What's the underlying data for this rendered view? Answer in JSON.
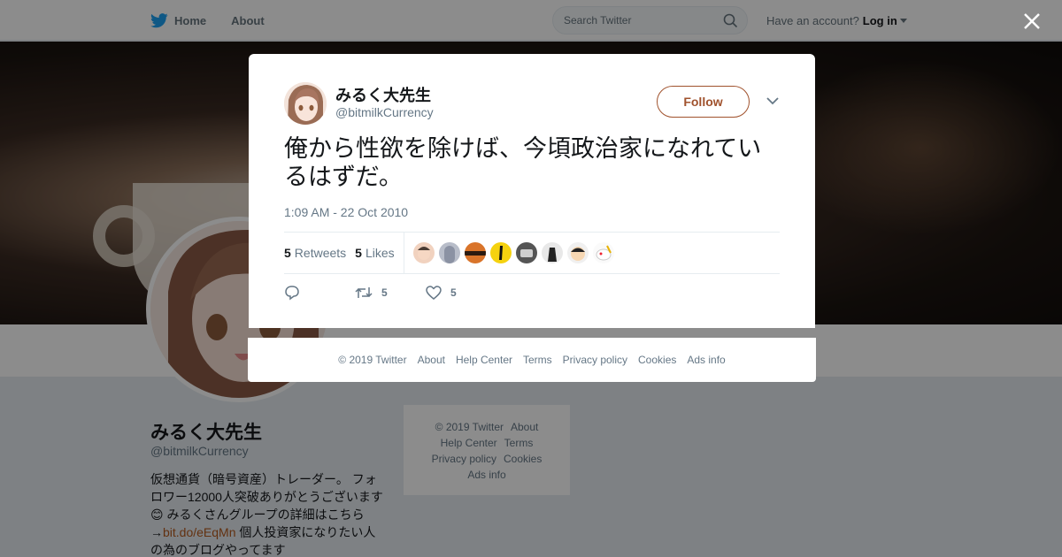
{
  "topbar": {
    "home_label": "Home",
    "about_label": "About",
    "search_placeholder": "Search Twitter",
    "account_prompt": "Have an account?",
    "login_label": "Log in"
  },
  "profile": {
    "name": "みるく大先生",
    "handle": "@bitmilkCurrency",
    "bio_part1": "仮想通貨（暗号資産）トレーダー。 フォロワー12000人突破ありがとうございます😊 みるくさんグループの詳細はこちら→",
    "bio_link": "bit.do/eEqMn",
    "bio_part2": " 個人投資家になりたい人の為のブログやってます"
  },
  "side_footer": {
    "copyright": "© 2019 Twitter",
    "about": "About",
    "help": "Help Center",
    "terms": "Terms",
    "privacy": "Privacy policy",
    "cookies": "Cookies",
    "ads": "Ads info"
  },
  "tweet": {
    "author_name": "みるく大先生",
    "author_handle": "@bitmilkCurrency",
    "follow_label": "Follow",
    "text": "俺から性欲を除けば、今頃政治家になれているはずだ。",
    "timestamp": "1:09 AM - 22 Oct 2010",
    "retweets_count": "5",
    "retweets_label": "Retweets",
    "likes_count": "5",
    "likes_label": "Likes",
    "action_retweets": "5",
    "action_likes": "5"
  },
  "modal_footer": {
    "copyright": "© 2019 Twitter",
    "about": "About",
    "help": "Help Center",
    "terms": "Terms",
    "privacy": "Privacy policy",
    "cookies": "Cookies",
    "ads": "Ads info"
  },
  "colors": {
    "accent": "#a0522d",
    "link": "#b45a1e",
    "twitter_blue": "#1da1f2"
  }
}
